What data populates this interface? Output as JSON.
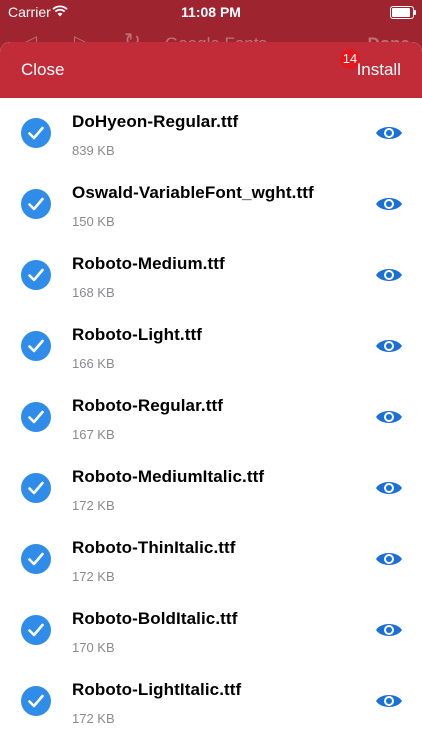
{
  "status_bar": {
    "carrier": "Carrier",
    "time": "11:08 PM"
  },
  "background_toolbar": {
    "title": "Google Fonts",
    "done_label": "Done"
  },
  "sheet": {
    "close_label": "Close",
    "install_label": "Install",
    "badge_count": "14"
  },
  "files": [
    {
      "name": "DoHyeon-Regular.ttf",
      "size": "839 KB",
      "checked": true
    },
    {
      "name": "Oswald-VariableFont_wght.ttf",
      "size": "150 KB",
      "checked": true
    },
    {
      "name": "Roboto-Medium.ttf",
      "size": "168 KB",
      "checked": true
    },
    {
      "name": "Roboto-Light.ttf",
      "size": "166 KB",
      "checked": true
    },
    {
      "name": "Roboto-Regular.ttf",
      "size": "167 KB",
      "checked": true
    },
    {
      "name": "Roboto-MediumItalic.ttf",
      "size": "172 KB",
      "checked": true
    },
    {
      "name": "Roboto-ThinItalic.ttf",
      "size": "172 KB",
      "checked": true
    },
    {
      "name": "Roboto-BoldItalic.ttf",
      "size": "170 KB",
      "checked": true
    },
    {
      "name": "Roboto-LightItalic.ttf",
      "size": "172 KB",
      "checked": true
    }
  ],
  "colors": {
    "header": "#c22c38",
    "checkmark": "#2f8ce9",
    "eye": "#1a6fd8",
    "badge": "#e0191f"
  },
  "icons": {
    "check": "checkmark-circle-icon",
    "preview": "eye-icon"
  }
}
